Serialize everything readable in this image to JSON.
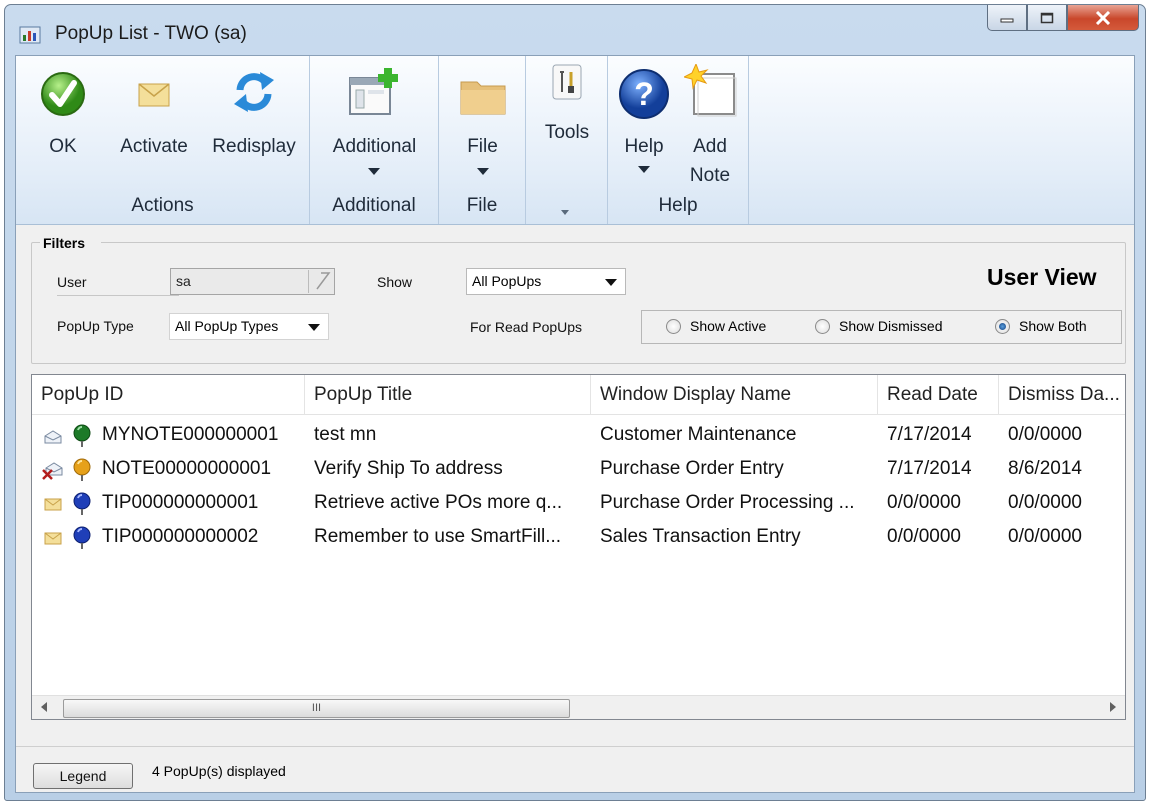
{
  "window": {
    "title": "PopUp List  -  TWO (sa)"
  },
  "ribbon": {
    "groups": [
      {
        "label": "Actions"
      },
      {
        "label": "Additional"
      },
      {
        "label": "File"
      },
      {
        "label": ""
      },
      {
        "label": "Help"
      }
    ],
    "buttons": {
      "ok": "OK",
      "activate": "Activate",
      "redisplay": "Redisplay",
      "additional": "Additional",
      "file": "File",
      "tools": "Tools",
      "help": "Help",
      "add_note_line1": "Add",
      "add_note_line2": "Note"
    }
  },
  "filters": {
    "title": "Filters",
    "user_label": "User",
    "user_value": "sa",
    "show_label": "Show",
    "show_value": "All PopUps",
    "popup_type_label": "PopUp Type",
    "popup_type_value": "All PopUp Types",
    "for_read_label": "For Read PopUps",
    "view_title": "User View",
    "radios": [
      {
        "label": "Show Active",
        "selected": false
      },
      {
        "label": "Show Dismissed",
        "selected": false
      },
      {
        "label": "Show Both",
        "selected": true
      }
    ]
  },
  "table": {
    "columns": [
      "PopUp ID",
      "PopUp Title",
      "Window Display Name",
      "Read Date",
      "Dismiss Da..."
    ],
    "rows": [
      {
        "id": "MYNOTE000000001",
        "title": "test mn",
        "window": "Customer Maintenance",
        "read": "7/17/2014",
        "dismiss": "0/0/0000",
        "envelope": "open",
        "pin": "green"
      },
      {
        "id": "NOTE00000000001",
        "title": "Verify Ship To address",
        "window": "Purchase Order Entry",
        "read": "7/17/2014",
        "dismiss": "8/6/2014",
        "envelope": "dismissed",
        "pin": "orange"
      },
      {
        "id": "TIP000000000001",
        "title": "Retrieve active POs more q...",
        "window": "Purchase Order Processing ...",
        "read": "0/0/0000",
        "dismiss": "0/0/0000",
        "envelope": "closed",
        "pin": "blue"
      },
      {
        "id": "TIP000000000002",
        "title": "Remember to use SmartFill...",
        "window": "Sales Transaction Entry",
        "read": "0/0/0000",
        "dismiss": "0/0/0000",
        "envelope": "closed",
        "pin": "blue"
      }
    ]
  },
  "scrollbar": {
    "thumb_label": "III"
  },
  "status": {
    "legend_button": "Legend",
    "count_text": "4 PopUp(s) displayed"
  },
  "colors": {
    "ribbon_bg": "#e3edf8",
    "pin_green": "#1d7a28",
    "pin_orange": "#e6a11a",
    "pin_blue": "#1f3fb8",
    "close_red": "#c9472b"
  }
}
